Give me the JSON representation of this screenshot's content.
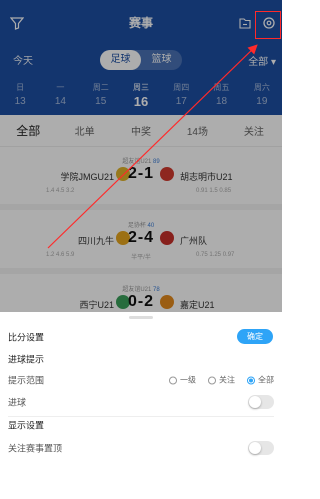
{
  "header": {
    "title": "赛事",
    "today_label": "今天",
    "sport_tabs": [
      {
        "label": "足球",
        "selected": true
      },
      {
        "label": "篮球",
        "selected": false
      }
    ],
    "filter_label": "全部 ▾",
    "days": [
      {
        "weekday": "日",
        "date": "13"
      },
      {
        "weekday": "一",
        "date": "14"
      },
      {
        "weekday": "周二",
        "date": "15"
      },
      {
        "weekday": "周三",
        "date": "16",
        "active": true
      },
      {
        "weekday": "周四",
        "date": "17"
      },
      {
        "weekday": "周五",
        "date": "18"
      },
      {
        "weekday": "周六",
        "date": "19"
      }
    ]
  },
  "tabs": [
    "全部",
    "北单",
    "中奖",
    "14场",
    "关注"
  ],
  "matches": [
    {
      "league": "超友谊U21",
      "league_num": "89",
      "home": "学院JMGU21",
      "away": "胡志明市U21",
      "score": "2-1",
      "odds_left": "1.4  4.5  3.2",
      "odds_mid": "",
      "odds_right": "0.91  1.5  0.85",
      "home_color": "#e0b32a",
      "away_color": "#d23a2e"
    },
    {
      "league": "足协杯",
      "league_num": "40",
      "home": "四川九牛",
      "away": "广州队",
      "score": "2-4",
      "odds_left": "1.2  4.6  5.9",
      "odds_mid": "半平/半",
      "odds_right": "0.75  1.25  0.97",
      "home_color": "#e6a51e",
      "away_color": "#c8302a"
    },
    {
      "league": "超友谊U21",
      "league_num": "78",
      "home": "西宁U21",
      "away": "嘉定U21",
      "score": "0-2",
      "odds_left": "",
      "odds_mid": "",
      "odds_right": "",
      "home_color": "#3aa05a",
      "away_color": "#e38a1c"
    }
  ],
  "sheet": {
    "title": "比分设置",
    "confirm_label": "确定",
    "goal_section": "进球提示",
    "range_label": "提示范围",
    "range_options": [
      {
        "label": "一级",
        "selected": false
      },
      {
        "label": "关注",
        "selected": false
      },
      {
        "label": "全部",
        "selected": true
      }
    ],
    "goal_label": "进球",
    "goal_on": false,
    "display_section": "显示设置",
    "pin_label": "关注赛事置顶",
    "pin_on": false
  },
  "colors": {
    "header_bg": "#1d4fa3",
    "accent": "#2ea4f7",
    "highlight_box": "#ff2a2a"
  }
}
